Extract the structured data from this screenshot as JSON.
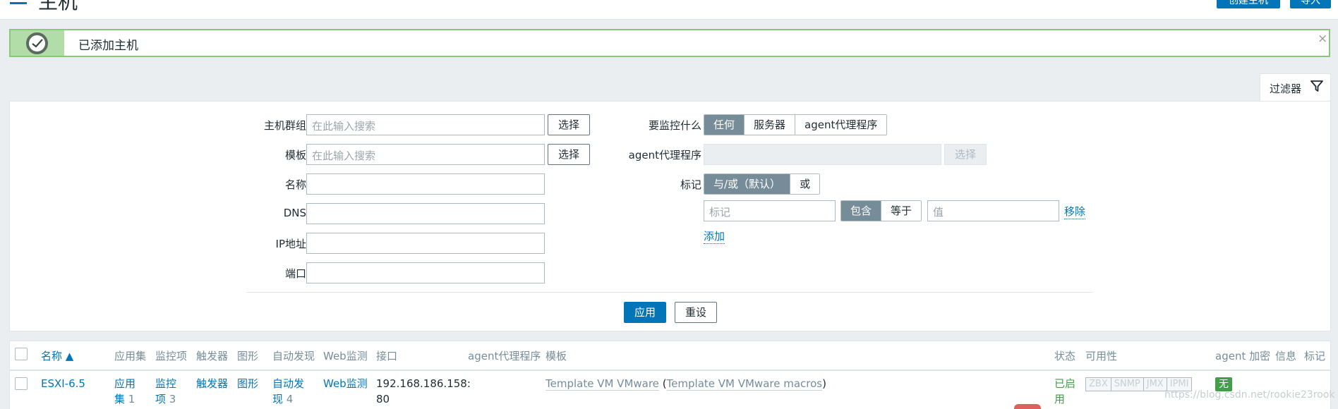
{
  "header": {
    "title": "主机",
    "create_host_button": "创建主机",
    "import_button": "导入"
  },
  "message": {
    "text": "已添加主机",
    "close": "×"
  },
  "filter_tab": {
    "label": "过滤器"
  },
  "filter": {
    "host_groups": {
      "label": "主机群组",
      "placeholder": "在此输入搜索",
      "select": "选择"
    },
    "templates": {
      "label": "模板",
      "placeholder": "在此输入搜索",
      "select": "选择"
    },
    "name": {
      "label": "名称",
      "value": ""
    },
    "dns": {
      "label": "DNS",
      "value": ""
    },
    "ip": {
      "label": "IP地址",
      "value": ""
    },
    "port": {
      "label": "端口",
      "value": ""
    },
    "monitored_by": {
      "label": "要监控什么",
      "options": [
        "任何",
        "服务器",
        "agent代理程序"
      ],
      "selected": "任何"
    },
    "proxy": {
      "label": "agent代理程序",
      "select": "选择"
    },
    "tags": {
      "label": "标记",
      "eval_options": [
        "与/或（默认）",
        "或"
      ],
      "eval_selected": "与/或（默认）",
      "tag_placeholder": "标记",
      "operator_options": [
        "包含",
        "等于"
      ],
      "operator_selected": "包含",
      "value_placeholder": "值",
      "remove": "移除",
      "add": "添加"
    },
    "apply": "应用",
    "reset": "重设"
  },
  "table": {
    "headers": {
      "name": "名称 ▲",
      "applications": "应用集",
      "items": "监控项",
      "triggers": "触发器",
      "graphs": "图形",
      "discovery": "自动发现",
      "web": "Web监测",
      "interface": "接口",
      "proxy": "agent代理程序",
      "templates": "模板",
      "status": "状态",
      "availability": "可用性",
      "encryption": "agent 加密",
      "info": "信息",
      "tags": "标记"
    },
    "rows": [
      {
        "name": "ESXI-6.5",
        "applications_l1": "应用",
        "applications_l2": "集",
        "applications_count": "1",
        "items_l1": "监控",
        "items_l2": "项",
        "items_count": "3",
        "triggers": "触发器",
        "graphs": "图形",
        "discovery_l1": "自动发",
        "discovery_l2": "现",
        "discovery_count": "4",
        "web": "Web监测",
        "interface_l1": "192.168.186.158:",
        "interface_l2": "80",
        "template": "Template VM VMware",
        "template_open": " (",
        "template_parent": "Template VM VMware macros",
        "template_close": ")",
        "status_l1": "已启",
        "status_l2": "用",
        "availability": [
          "ZBX",
          "SNMP",
          "JMX",
          "IPMI"
        ],
        "encryption": "无"
      }
    ]
  },
  "watermark": "https://blog.csdn.net/rookie23rook"
}
